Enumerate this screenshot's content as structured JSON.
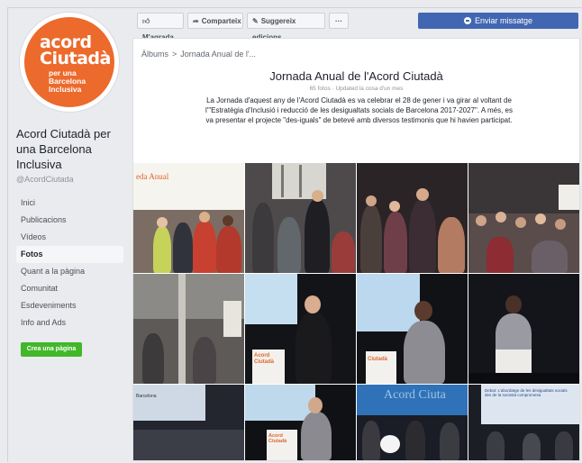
{
  "page": {
    "logo_line1": "acord",
    "logo_line2": "Ciutadà",
    "logo_small": [
      "per una",
      "Barcelona",
      "Inclusiva"
    ],
    "name": "Acord Ciutadà per una Barcelona Inclusiva",
    "handle": "@AcordCiutada"
  },
  "nav": [
    {
      "label": "Inici",
      "active": false
    },
    {
      "label": "Publicacions",
      "active": false
    },
    {
      "label": "Vídeos",
      "active": false
    },
    {
      "label": "Fotos",
      "active": true
    },
    {
      "label": "Quant a la pàgina",
      "active": false
    },
    {
      "label": "Comunitat",
      "active": false
    },
    {
      "label": "Esdeveniments",
      "active": false
    },
    {
      "label": "Info and Ads",
      "active": false
    }
  ],
  "create_page": "Crea una pàgina",
  "toolbar": {
    "like": "M'agrada",
    "share": "Comparteix",
    "suggest": "Suggereix edicions",
    "more": "···",
    "send_message": "Enviar missatge"
  },
  "breadcrumb": {
    "root": "Àlbums",
    "separator": ">",
    "current": "Jornada Anual de l'..."
  },
  "album": {
    "title": "Jornada Anual de l'Acord Ciutadà",
    "meta": "65 fotos · Updated la cosa d'un mes",
    "description": "La Jornada d'aquest any de l'Acord Ciutadà es va celebrar el 28 de gener i va girar al voltant de l'\"Estratègia d'Inclusió i reducció de les desigualtats socials de Barcelona 2017-2027\". A més, es va presentar el projecte \"des-iguals\" de betevé amb diversos testimonis que hi havien participat."
  },
  "photos": [
    {
      "kind": "crowd-banner",
      "caption": "eda Anual"
    },
    {
      "kind": "crowd-hall",
      "caption": ""
    },
    {
      "kind": "crowd-dark",
      "caption": ""
    },
    {
      "kind": "crowd-seated",
      "caption": ""
    },
    {
      "kind": "hall-window",
      "caption": ""
    },
    {
      "kind": "speaker-blue",
      "caption": "Acord Ciutadà"
    },
    {
      "kind": "speaker-podium",
      "caption": "Ciutadà"
    },
    {
      "kind": "speaker-dark",
      "caption": ""
    },
    {
      "kind": "slide-audience",
      "caption": "Barcelona"
    },
    {
      "kind": "speaker-screen",
      "caption": "Acord Ciutadà"
    },
    {
      "kind": "panel-blue",
      "caption": "Acord Ciuta"
    },
    {
      "kind": "panel-slide",
      "caption": "Debat: L'abordatge de les desigualtats socials des de la societat compromesa"
    }
  ],
  "colors": {
    "brand_orange": "#ec6a2c",
    "fb_blue": "#4267b2",
    "create_green": "#42b72a"
  }
}
